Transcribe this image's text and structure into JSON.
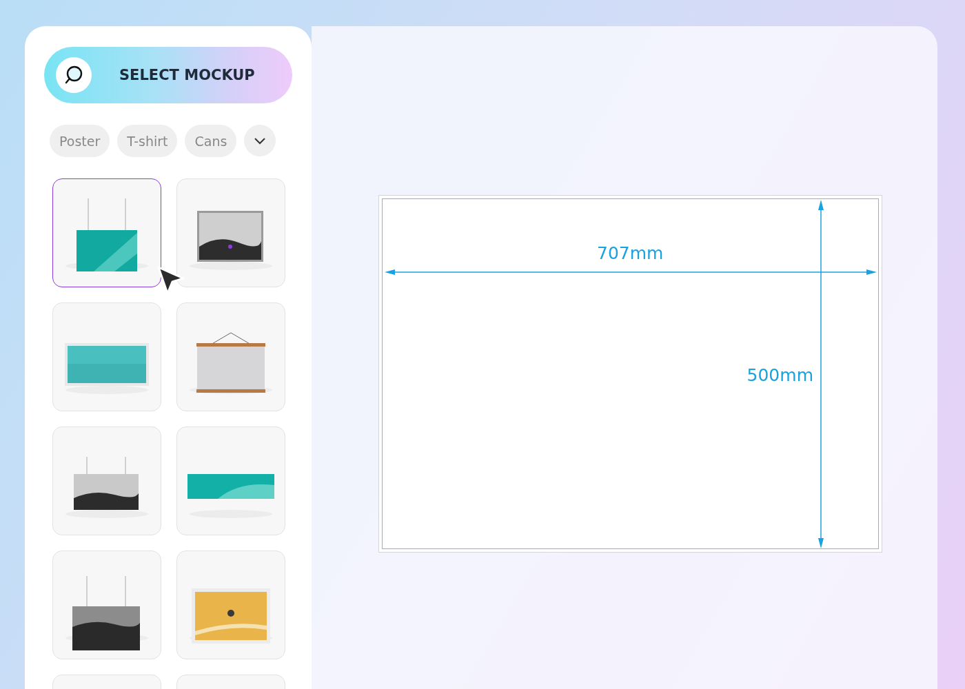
{
  "sidebar": {
    "select_button": {
      "label": "SELECT MOCKUP"
    },
    "categories": [
      {
        "label": "Poster"
      },
      {
        "label": "T-shirt"
      },
      {
        "label": "Cans"
      }
    ],
    "thumbnails": [
      {
        "kind": "picture",
        "selected": true
      },
      {
        "kind": "picture",
        "selected": false
      },
      {
        "kind": "picture",
        "selected": false
      },
      {
        "kind": "picture",
        "selected": false
      },
      {
        "kind": "picture",
        "selected": false
      },
      {
        "kind": "picture",
        "selected": false
      },
      {
        "kind": "picture",
        "selected": false
      },
      {
        "kind": "picture",
        "selected": false
      },
      {
        "kind": "blank",
        "selected": false
      },
      {
        "kind": "blank",
        "selected": false
      }
    ]
  },
  "canvas": {
    "width_label": "707mm",
    "height_label": "500mm"
  }
}
